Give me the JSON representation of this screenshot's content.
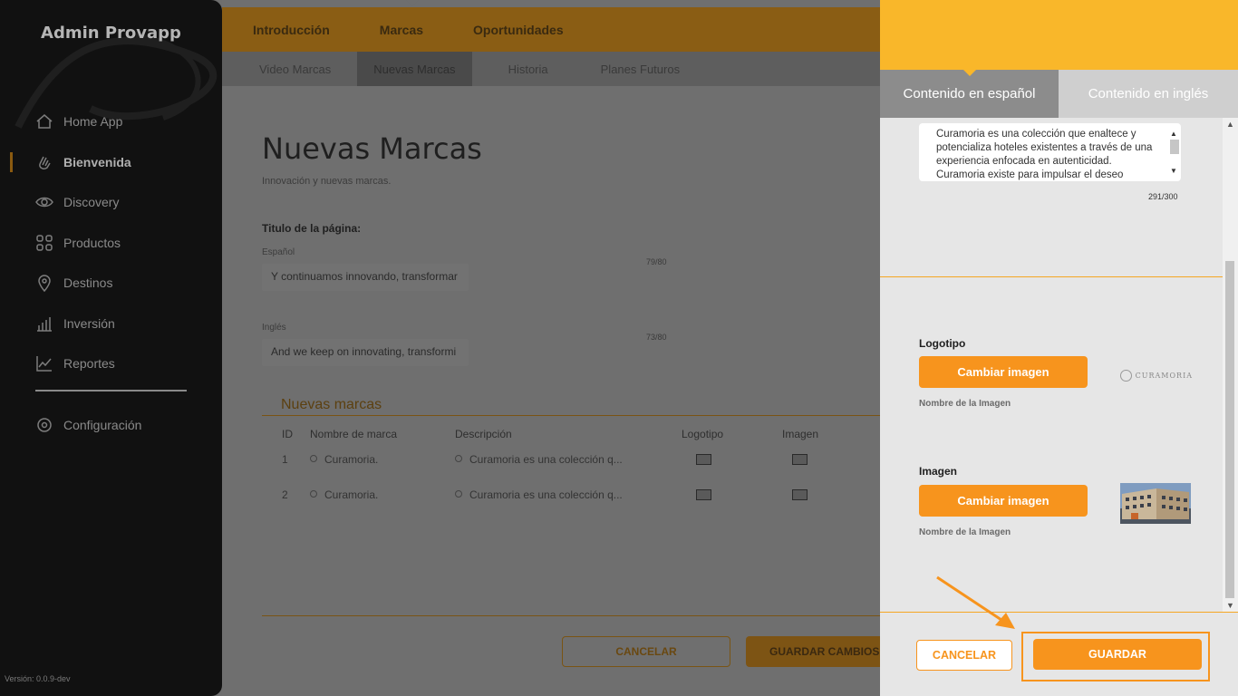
{
  "sidebar": {
    "brand": "Admin Provapp",
    "items": [
      {
        "label": "Home App",
        "icon": "home-icon"
      },
      {
        "label": "Bienvenida",
        "icon": "wave-hand-icon",
        "active": true
      },
      {
        "label": "Discovery",
        "icon": "eye-icon"
      },
      {
        "label": "Productos",
        "icon": "grid-icon"
      },
      {
        "label": "Destinos",
        "icon": "location-pin-icon"
      },
      {
        "label": "Inversión",
        "icon": "bar-chart-icon"
      },
      {
        "label": "Reportes",
        "icon": "line-chart-icon"
      }
    ],
    "config": {
      "label": "Configuración",
      "icon": "gear-icon"
    },
    "version": "Versión: 0.0.9-dev"
  },
  "topbar": {
    "tabs": [
      "Introducción",
      "Marcas",
      "Oportunidades"
    ],
    "active": "Marcas"
  },
  "subbar": {
    "tabs": [
      "Video Marcas",
      "Nuevas Marcas",
      "Historia",
      "Planes Futuros"
    ],
    "active": "Nuevas Marcas"
  },
  "page": {
    "title": "Nuevas Marcas",
    "subtitle": "Innovación y nuevas marcas.",
    "field_title": "Titulo de la página:",
    "es_label": "Español",
    "es_value": "Y continuamos innovando, transformar",
    "es_count": "79/80",
    "en_label": "Inglés",
    "en_value": "And we keep on innovating, transformi",
    "en_count": "73/80",
    "section_title": "Nuevas marcas",
    "table": {
      "headers": [
        "ID",
        "Nombre de marca",
        "Descripción",
        "Logotipo",
        "Imagen"
      ],
      "rows": [
        {
          "id": "1",
          "name": "Curamoria.",
          "desc": "Curamoria es una colección q..."
        },
        {
          "id": "2",
          "name": "Curamoria.",
          "desc": "Curamoria es una colección q..."
        }
      ]
    },
    "cancel_label": "CANCELAR",
    "save_label": "GUARDAR CAMBIOS"
  },
  "panel": {
    "tabs": [
      "Contenido en español",
      "Contenido en inglés"
    ],
    "active_tab": "Contenido en español",
    "description": "Curamoria es una colección que enaltece y potencializa hoteles existentes a través de una experiencia enfocada en autenticidad. Curamoria existe para impulsar el deseo",
    "char_count": "291/300",
    "logo_label": "Logotipo",
    "logo_button": "Cambiar imagen",
    "logo_image_name": "Nombre de la Imagen",
    "logo_thumb_text": "CURAMORIA",
    "image_label": "Imagen",
    "image_button": "Cambiar imagen",
    "image_image_name": "Nombre de la Imagen",
    "cancel_label": "CANCELAR",
    "save_label": "GUARDAR"
  },
  "colors": {
    "accent": "#f7941d",
    "header_yellow": "#f9b72a",
    "sidebar_bg": "#111111"
  }
}
